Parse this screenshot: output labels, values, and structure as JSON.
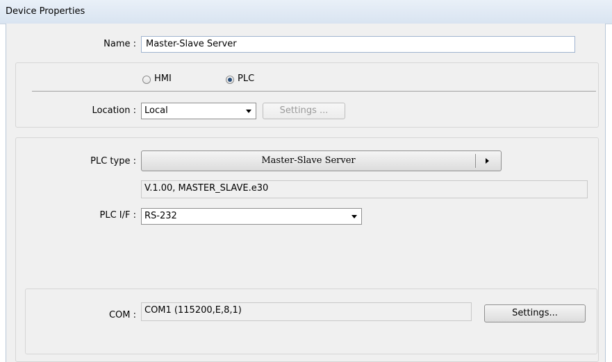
{
  "window": {
    "title": "Device Properties"
  },
  "name_field": {
    "label": "Name :",
    "value": "Master-Slave Server"
  },
  "device_group": {
    "radios": [
      {
        "label": "HMI",
        "selected": false
      },
      {
        "label": "PLC",
        "selected": true
      }
    ],
    "location_label": "Location :",
    "location_value": "Local",
    "settings_button": "Settings ..."
  },
  "plc_group": {
    "plc_type_label": "PLC type :",
    "plc_type_value": "Master-Slave Server",
    "version_text": "V.1.00, MASTER_SLAVE.e30",
    "plc_if_label": "PLC I/F :",
    "plc_if_value": "RS-232"
  },
  "com_group": {
    "com_label": "COM :",
    "com_value": "COM1 (115200,E,8,1)",
    "settings_button": "Settings..."
  }
}
